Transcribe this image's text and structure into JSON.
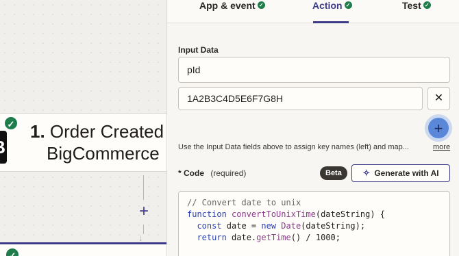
{
  "canvas": {
    "step": {
      "number": "1.",
      "title": "Order Created",
      "app": "BigCommerce"
    },
    "add_step_symbol": "+",
    "arrow_symbol": "↓"
  },
  "tabs": [
    {
      "label": "App & event",
      "complete": true
    },
    {
      "label": "Action",
      "complete": true,
      "active": true
    },
    {
      "label": "Test",
      "complete": true
    }
  ],
  "input_data": {
    "label": "Input Data",
    "key_value": "pId",
    "value_value": "1A2B3C4D5E6F7G8H",
    "remove_symbol": "✕",
    "add_symbol": "+",
    "hint": "Use the Input Data fields above to assign key names (left) and map...",
    "more_label": "more"
  },
  "code": {
    "required_star": "*",
    "label": "Code",
    "required_label": "(required)",
    "beta_label": "Beta",
    "ai_button_label": "Generate with AI",
    "lines": [
      {
        "comment": "// Convert date to unix"
      },
      {
        "kw": "function",
        "fn": "convertToUnixTime",
        "rest": "(dateString) {"
      },
      {
        "indent": "  ",
        "kw": "const",
        "mid": " date = ",
        "kw2": "new",
        "fn": " Date",
        "rest": "(dateString);"
      },
      {
        "indent": "  ",
        "kw": "return",
        "rest": " date.",
        "fn": "getTime",
        "rest2": "() / 1000;"
      }
    ]
  },
  "colors": {
    "accent": "#3d3a8a",
    "success": "#1e7d4a",
    "add_button": "#5a87d8"
  }
}
